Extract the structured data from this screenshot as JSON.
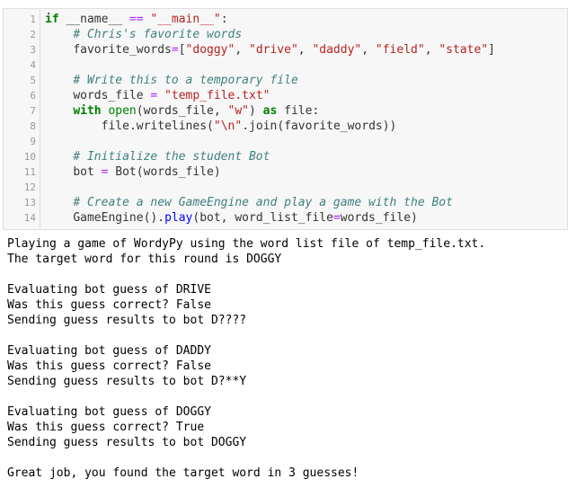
{
  "cell": {
    "line_numbers": [
      "1",
      "2",
      "3",
      "4",
      "5",
      "6",
      "7",
      "8",
      "9",
      "10",
      "11",
      "12",
      "13",
      "14"
    ],
    "code": {
      "l1": {
        "kw_if": "if",
        "name": "__name__",
        "eq": "==",
        "main": "\"__main__\"",
        "colon": ":"
      },
      "l2": {
        "comment": "# Chris's favorite words"
      },
      "l3": {
        "var": "favorite_words",
        "eq": "=",
        "open": "[",
        "w1": "\"doggy\"",
        "c1": ", ",
        "w2": "\"drive\"",
        "c2": ", ",
        "w3": "\"daddy\"",
        "c3": ", ",
        "w4": "\"field\"",
        "c4": ", ",
        "w5": "\"state\"",
        "close": "]"
      },
      "l5": {
        "comment": "# Write this to a temporary file"
      },
      "l6": {
        "var": "words_file",
        "eq": "=",
        "value": "\"temp_file.txt\""
      },
      "l7": {
        "kw_with": "with",
        "fn_open": "open",
        "args_a": "(words_file, ",
        "mode": "\"w\"",
        "args_b": ") ",
        "kw_as": "as",
        "target": " file:"
      },
      "l8": {
        "obj": "file",
        "dot1": ".",
        "method": "writelines",
        "paren_o": "(",
        "sep": "\"\\n\"",
        "dot2": ".",
        "join": "join",
        "rest": "(favorite_words))"
      },
      "l10": {
        "comment": "# Initialize the student Bot"
      },
      "l11": {
        "var": "bot",
        "eq": "=",
        "rest": "Bot(words_file)"
      },
      "l13": {
        "comment": "# Create a new GameEngine and play a game with the Bot"
      },
      "l14": {
        "cls": "GameEngine()",
        "dot": ".",
        "method": "play",
        "args_a": "(bot, word_list_file",
        "eq": "=",
        "args_b": "words_file)"
      }
    }
  },
  "output": {
    "lines": [
      "Playing a game of WordyPy using the word list file of temp_file.txt.",
      "The target word for this round is DOGGY",
      "",
      "Evaluating bot guess of DRIVE",
      "Was this guess correct? False",
      "Sending guess results to bot D????",
      "",
      "Evaluating bot guess of DADDY",
      "Was this guess correct? False",
      "Sending guess results to bot D?**Y",
      "",
      "Evaluating bot guess of DOGGY",
      "Was this guess correct? True",
      "Sending guess results to bot DOGGY",
      "",
      "Great job, you found the target word in 3 guesses!"
    ]
  }
}
